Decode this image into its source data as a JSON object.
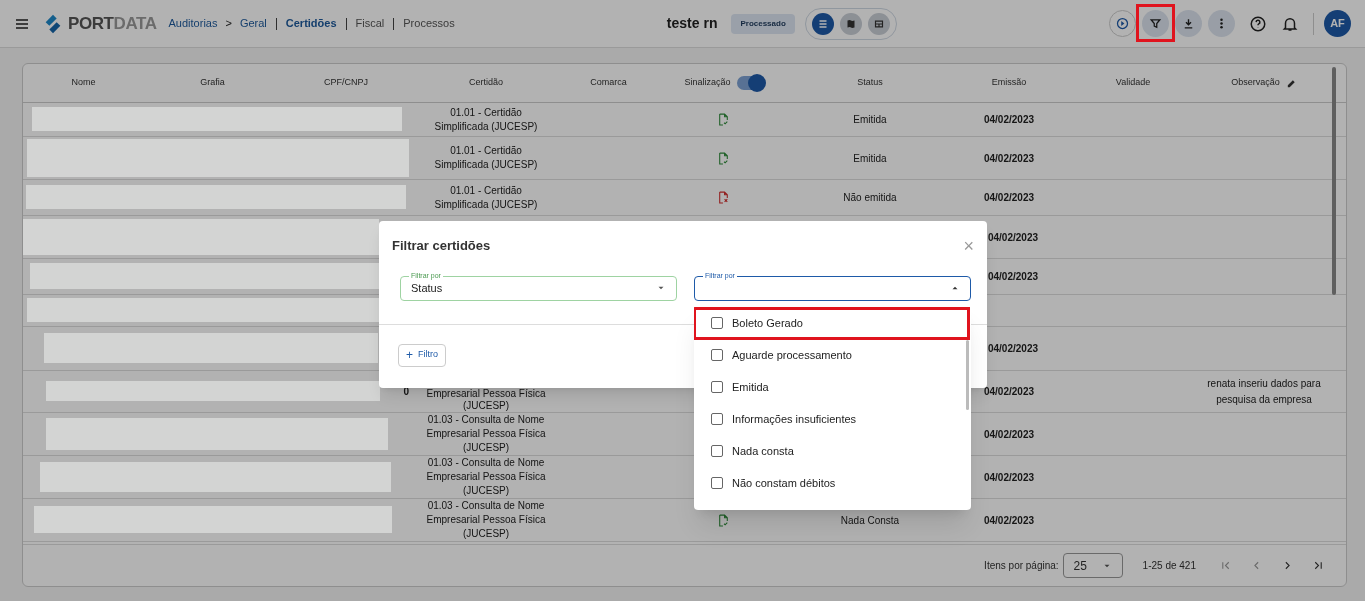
{
  "topbar": {
    "logo": "**PORT**DATA",
    "breadcrumb": [
      "Auditorias",
      "Geral"
    ],
    "breadcrumb_separator": ">",
    "tabs": [
      {
        "label": "Certidões",
        "selected": true
      },
      {
        "label": "Fiscal",
        "selected": false
      },
      {
        "label": "Processos",
        "selected": false
      }
    ],
    "project": "teste rn",
    "badge": "Processado",
    "views": [
      {
        "kind": "list",
        "selected": true
      },
      {
        "kind": "map",
        "selected": false
      },
      {
        "kind": "grid",
        "selected": false
      }
    ],
    "actions": [
      {
        "kind": "play",
        "highlighted": false
      },
      {
        "kind": "filter",
        "highlighted": true
      },
      {
        "kind": "download",
        "highlighted": false
      },
      {
        "kind": "more",
        "highlighted": false
      }
    ],
    "avatar": "AF"
  },
  "table": {
    "columns": [
      "Nome",
      "Grafia",
      "CPF/CNPJ",
      "Certidão",
      "Comarca",
      "Sinalização",
      "Status",
      "Emissão",
      "Validade",
      "Observação"
    ],
    "signal_toggle_on": true,
    "rows": [
      {
        "certidao": "01.01 - Certidão Simplificada (JUCESP)",
        "signal_ok": true,
        "status": "Emitida",
        "emissao": "04/02/2023"
      },
      {
        "certidao": "01.01 - Certidão Simplificada (JUCESP)",
        "signal_ok": true,
        "status": "Emitida",
        "emissao": "04/02/2023"
      },
      {
        "certidao": "01.01 - Certidão Simplificada (JUCESP)",
        "signal_ok": false,
        "status": "Não emitida",
        "emissao": "04/02/2023"
      },
      {
        "emissao": "04/02/2023"
      },
      {
        "emissao": "04/02/2023"
      },
      {},
      {
        "emissao": "04/02/2023"
      },
      {
        "cpf": "0",
        "certidao": "Empresarial Pessoa Física (JUCESP)",
        "emissao": "04/02/2023",
        "observacao": "renata inseriu dados para pesquisa da empresa"
      },
      {
        "certidao": "01.03 - Consulta de Nome Empresarial Pessoa Física (JUCESP)",
        "emissao": "04/02/2023"
      },
      {
        "certidao": "01.03 - Consulta de Nome Empresarial Pessoa Física (JUCESP)",
        "emissao": "04/02/2023"
      },
      {
        "certidao": "01.03 - Consulta de Nome Empresarial Pessoa Física (JUCESP)",
        "signal_ok": true,
        "status": "Nada Consta",
        "emissao": "04/02/2023"
      }
    ]
  },
  "paginator": {
    "label": "Itens por página:",
    "page_size": "25",
    "range": "1-25 de 421"
  },
  "dialog": {
    "title": "Filtrar certidões",
    "close": "×",
    "field_1": {
      "label": "Filtrar por",
      "value": "Status"
    },
    "field_2": {
      "label": "Filtrar por",
      "expanded": true
    },
    "add_button": "Filtro",
    "add_icon": "+",
    "options": [
      {
        "label": "Boleto Gerado",
        "checked": false,
        "highlighted": true
      },
      {
        "label": "Aguarde processamento",
        "checked": false,
        "highlighted": false
      },
      {
        "label": "Emitida",
        "checked": false,
        "highlighted": false
      },
      {
        "label": "Informações insuficientes",
        "checked": false,
        "highlighted": false
      },
      {
        "label": "Nada consta",
        "checked": false,
        "highlighted": false
      },
      {
        "label": "Não constam débitos",
        "checked": false,
        "highlighted": false
      }
    ]
  }
}
